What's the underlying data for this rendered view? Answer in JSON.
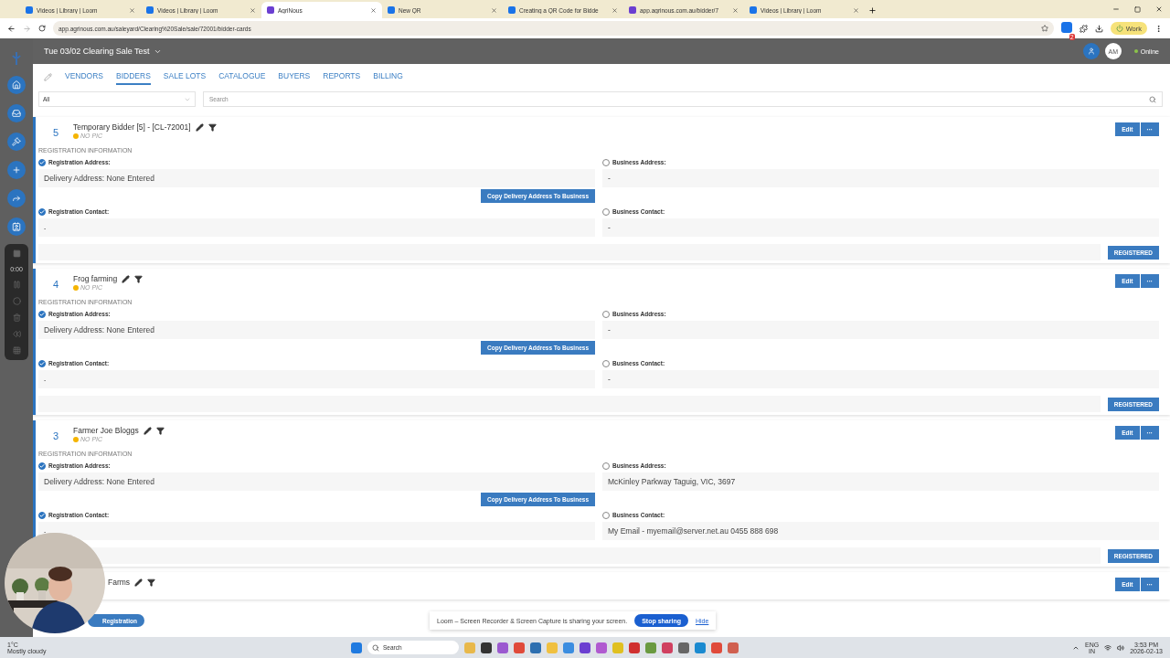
{
  "browser": {
    "tabs": [
      {
        "title": "Videos | Library | Loom",
        "selected": false
      },
      {
        "title": "Videos | Library | Loom",
        "selected": false
      },
      {
        "title": "AgriNous",
        "selected": true
      },
      {
        "title": "New QR",
        "selected": false
      },
      {
        "title": "Creating a QR Code for Bidde",
        "selected": false
      },
      {
        "title": "app.agrinous.com.au/bidder/7",
        "selected": false
      },
      {
        "title": "Videos | Library | Loom",
        "selected": false
      }
    ],
    "url": "app.agrinous.com.au/saleyard/Clearing%20Sale/sale/72001/bidder-cards",
    "profile": "Work",
    "extension_badge": "2"
  },
  "header": {
    "sale_title": "Tue 03/02 Clearing Sale Test",
    "user_initials": "AM",
    "status": "Online"
  },
  "recorder": {
    "time": "0:00"
  },
  "nav_tabs": [
    {
      "label": "VENDORS",
      "selected": false
    },
    {
      "label": "BIDDERS",
      "selected": true
    },
    {
      "label": "SALE LOTS",
      "selected": false
    },
    {
      "label": "CATALOGUE",
      "selected": false
    },
    {
      "label": "BUYERS",
      "selected": false
    },
    {
      "label": "REPORTS",
      "selected": false
    },
    {
      "label": "BILLING",
      "selected": false
    }
  ],
  "filter": {
    "value": "All"
  },
  "search": {
    "placeholder": "Search"
  },
  "bidders": [
    {
      "kind": "full",
      "number": "5",
      "name": "Temporary Bidder [5] - [CL-72001]",
      "pic_status": "NO PIC",
      "section": "REGISTRATION INFORMATION",
      "registration_address": {
        "label": "Registration Address:",
        "checked": true,
        "value": "Delivery Address: None Entered"
      },
      "copy_button": "Copy Delivery Address To Business",
      "registration_contact": {
        "label": "Registration Contact:",
        "checked": true,
        "value": "-"
      },
      "business_address": {
        "label": "Business Address:",
        "checked": false,
        "value": "-"
      },
      "business_contact": {
        "label": "Business Contact:",
        "checked": false,
        "value": "-"
      },
      "status": "REGISTERED",
      "edit": "Edit",
      "more": "···"
    },
    {
      "kind": "full",
      "number": "4",
      "name": "Frog farming",
      "pic_status": "NO PIC",
      "section": "REGISTRATION INFORMATION",
      "registration_address": {
        "label": "Registration Address:",
        "checked": true,
        "value": "Delivery Address: None Entered"
      },
      "copy_button": "Copy Delivery Address To Business",
      "registration_contact": {
        "label": "Registration Contact:",
        "checked": true,
        "value": "-"
      },
      "business_address": {
        "label": "Business Address:",
        "checked": false,
        "value": "-"
      },
      "business_contact": {
        "label": "Business Contact:",
        "checked": false,
        "value": "-"
      },
      "status": "REGISTERED",
      "edit": "Edit",
      "more": "···"
    },
    {
      "kind": "full",
      "number": "3",
      "name": "Farmer Joe Bloggs",
      "pic_status": "NO PIC",
      "section": "REGISTRATION INFORMATION",
      "registration_address": {
        "label": "Registration Address:",
        "checked": true,
        "value": "Delivery Address: None Entered"
      },
      "copy_button": "Copy Delivery Address To Business",
      "registration_contact": {
        "label": "Registration Contact:",
        "checked": true,
        "value": "-"
      },
      "business_address": {
        "label": "Business Address:",
        "checked": false,
        "value": "McKinley Parkway Taguig, VIC, 3697"
      },
      "business_contact": {
        "label": "Business Contact:",
        "checked": false,
        "value": "My Email - myemail@server.net.au 0455 888 698"
      },
      "status": "REGISTERED",
      "edit": "Edit",
      "more": "···"
    },
    {
      "kind": "partial",
      "name": "Farms",
      "edit": "Edit",
      "more": "···"
    }
  ],
  "fab": {
    "label": "Registration"
  },
  "share_notice": {
    "text": "Loom – Screen Recorder & Screen Capture is sharing your screen.",
    "stop": "Stop sharing",
    "hide": "Hide"
  },
  "taskbar": {
    "temperature": "1°C",
    "weather": "Mostly cloudy",
    "search": "Search",
    "language": "ENG",
    "region": "IN",
    "time": "3:53 PM",
    "date": "2026-02-13"
  }
}
